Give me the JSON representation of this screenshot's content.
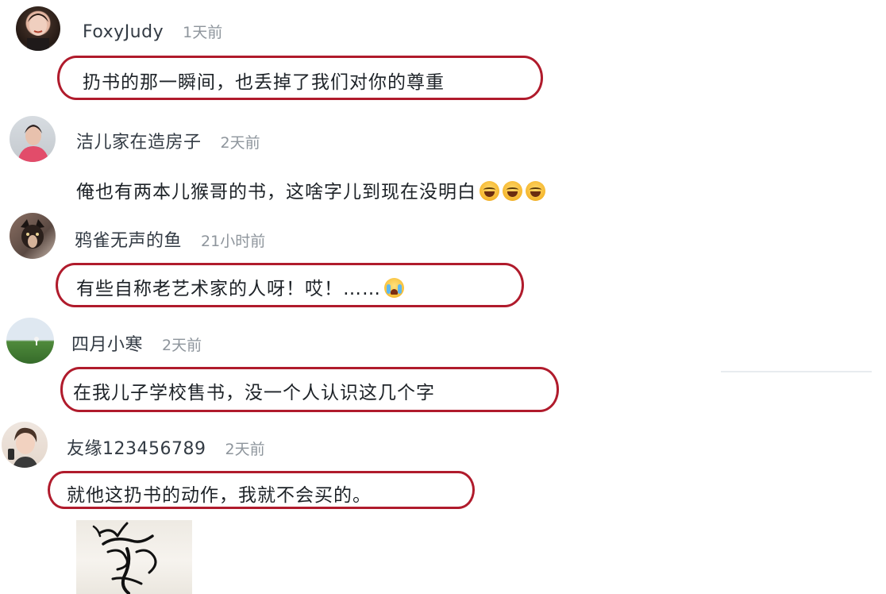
{
  "comments": [
    {
      "username": "FoxyJudy",
      "time": "1天前",
      "text": "扔书的那一瞬间，也丢掉了我们对你的尊重",
      "highlighted": true
    },
    {
      "username": "洁儿家在造房子",
      "time": "2天前",
      "text": "俺也有两本儿猴哥的书，这啥字儿到现在没明白",
      "emoji": "laughing-tears-icon",
      "emoji_count": 3,
      "highlighted": false
    },
    {
      "username": "鸦雀无声的鱼",
      "time": "21小时前",
      "text": "有些自称老艺术家的人呀！哎！……",
      "emoji": "crying-icon",
      "emoji_count": 1,
      "highlighted": true
    },
    {
      "username": "四月小寒",
      "time": "2天前",
      "text": "在我儿子学校售书，没一个人认识这几个字",
      "highlighted": true
    },
    {
      "username": "友缘123456789",
      "time": "2天前",
      "text": "就他这扔书的动作，我就不会买的。",
      "highlighted": true
    }
  ],
  "attachment": {
    "type": "calligraphy-image"
  },
  "colors": {
    "highlight_border": "#b01b2c",
    "username": "#333b44",
    "time": "#8e959c",
    "text": "#1d2227"
  }
}
